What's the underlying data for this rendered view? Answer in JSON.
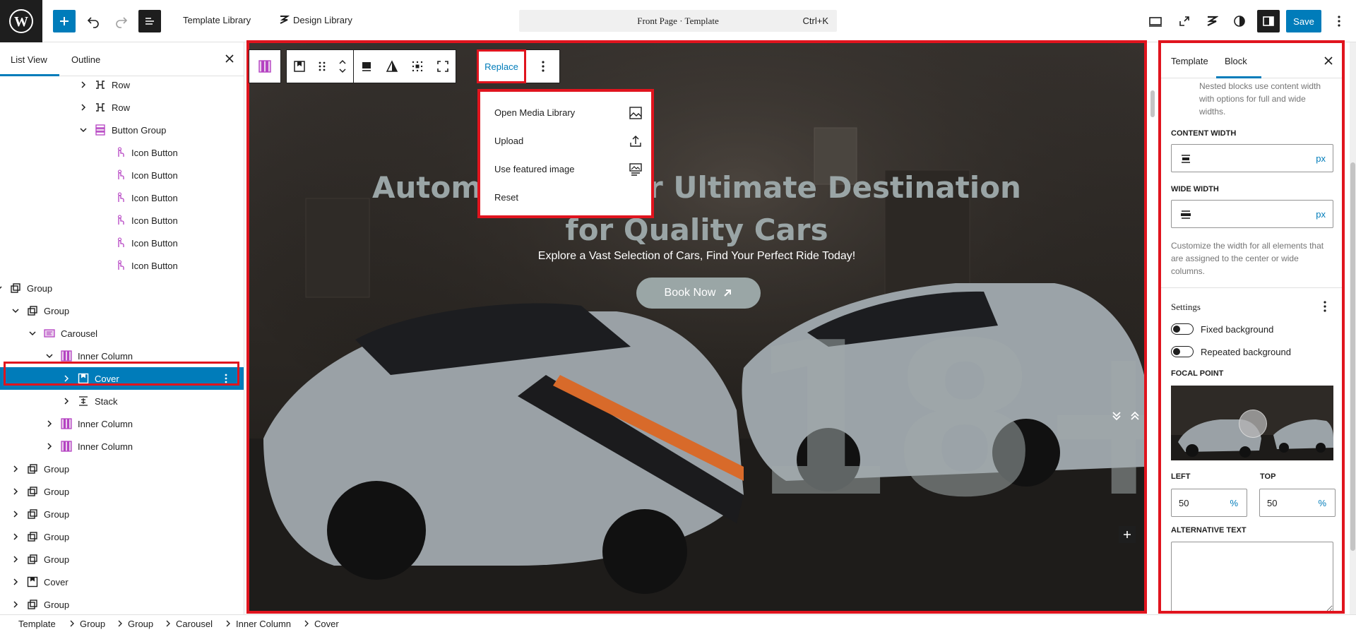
{
  "topbar": {
    "template_library": "Template Library",
    "design_library": "Design Library",
    "command_title": "Front Page · Template",
    "command_shortcut": "Ctrl+K",
    "save_label": "Save"
  },
  "list_panel": {
    "tabs": [
      "List View",
      "Outline"
    ],
    "items": [
      {
        "label": "Row",
        "icon": "row-icon",
        "expanded": false
      },
      {
        "label": "Row",
        "icon": "row-icon",
        "expanded": false
      },
      {
        "label": "Button Group",
        "icon": "button-group-icon",
        "expanded": true
      },
      {
        "label": "Icon Button",
        "icon": "icon-button-icon"
      },
      {
        "label": "Icon Button",
        "icon": "icon-button-icon"
      },
      {
        "label": "Icon Button",
        "icon": "icon-button-icon"
      },
      {
        "label": "Icon Button",
        "icon": "icon-button-icon"
      },
      {
        "label": "Icon Button",
        "icon": "icon-button-icon"
      },
      {
        "label": "Icon Button",
        "icon": "icon-button-icon"
      },
      {
        "label": "Group",
        "icon": "group-icon",
        "expanded": true
      },
      {
        "label": "Group",
        "icon": "group-icon",
        "expanded": true
      },
      {
        "label": "Carousel",
        "icon": "carousel-icon",
        "expanded": true
      },
      {
        "label": "Inner Column",
        "icon": "inner-column-icon",
        "expanded": true
      },
      {
        "label": "Cover",
        "icon": "cover-icon",
        "selected": true
      },
      {
        "label": "Stack",
        "icon": "stack-icon",
        "expanded": false
      },
      {
        "label": "Inner Column",
        "icon": "inner-column-icon",
        "expanded": false
      },
      {
        "label": "Inner Column",
        "icon": "inner-column-icon",
        "expanded": false
      },
      {
        "label": "Group",
        "icon": "group-icon",
        "expanded": false
      },
      {
        "label": "Group",
        "icon": "group-icon",
        "expanded": false
      },
      {
        "label": "Group",
        "icon": "group-icon",
        "expanded": false
      },
      {
        "label": "Group",
        "icon": "group-icon",
        "expanded": false
      },
      {
        "label": "Group",
        "icon": "group-icon",
        "expanded": false
      },
      {
        "label": "Cover",
        "icon": "cover-icon",
        "expanded": false
      },
      {
        "label": "Group",
        "icon": "group-icon",
        "expanded": false
      }
    ]
  },
  "block_toolbar": {
    "replace_label": "Replace"
  },
  "replace_menu": {
    "items": [
      {
        "label": "Open Media Library",
        "icon": "image-icon"
      },
      {
        "label": "Upload",
        "icon": "upload-icon"
      },
      {
        "label": "Use featured image",
        "icon": "featured-image-icon"
      },
      {
        "label": "Reset",
        "icon": ""
      }
    ]
  },
  "hero": {
    "title_line1": "Automotive: Your Ultimate Destination",
    "title_line2": "for Quality Cars",
    "subtitle": "Explore a Vast Selection of Cars, Find Your Perfect Ride Today!",
    "button_label": "Book Now",
    "big_number": "18+"
  },
  "settings_panel": {
    "tabs": [
      "Template",
      "Block"
    ],
    "layout_help": "Nested blocks use content width with options for full and wide widths.",
    "content_width_label": "CONTENT WIDTH",
    "content_width_unit": "px",
    "wide_width_label": "WIDE WIDTH",
    "wide_width_unit": "px",
    "width_help": "Customize the width for all elements that are assigned to the center or wide columns.",
    "settings_title": "Settings",
    "fixed_background": "Fixed background",
    "repeated_background": "Repeated background",
    "focal_point_label": "FOCAL POINT",
    "left_label": "LEFT",
    "left_value": "50",
    "left_unit": "%",
    "top_label": "TOP",
    "top_value": "50",
    "top_unit": "%",
    "alt_text_label": "ALTERNATIVE TEXT"
  },
  "breadcrumb": [
    "Template",
    "Group",
    "Group",
    "Carousel",
    "Inner Column",
    "Cover"
  ],
  "colors": {
    "accent": "#007cba",
    "highlight": "#e0141e",
    "dark": "#1e1e1e"
  }
}
